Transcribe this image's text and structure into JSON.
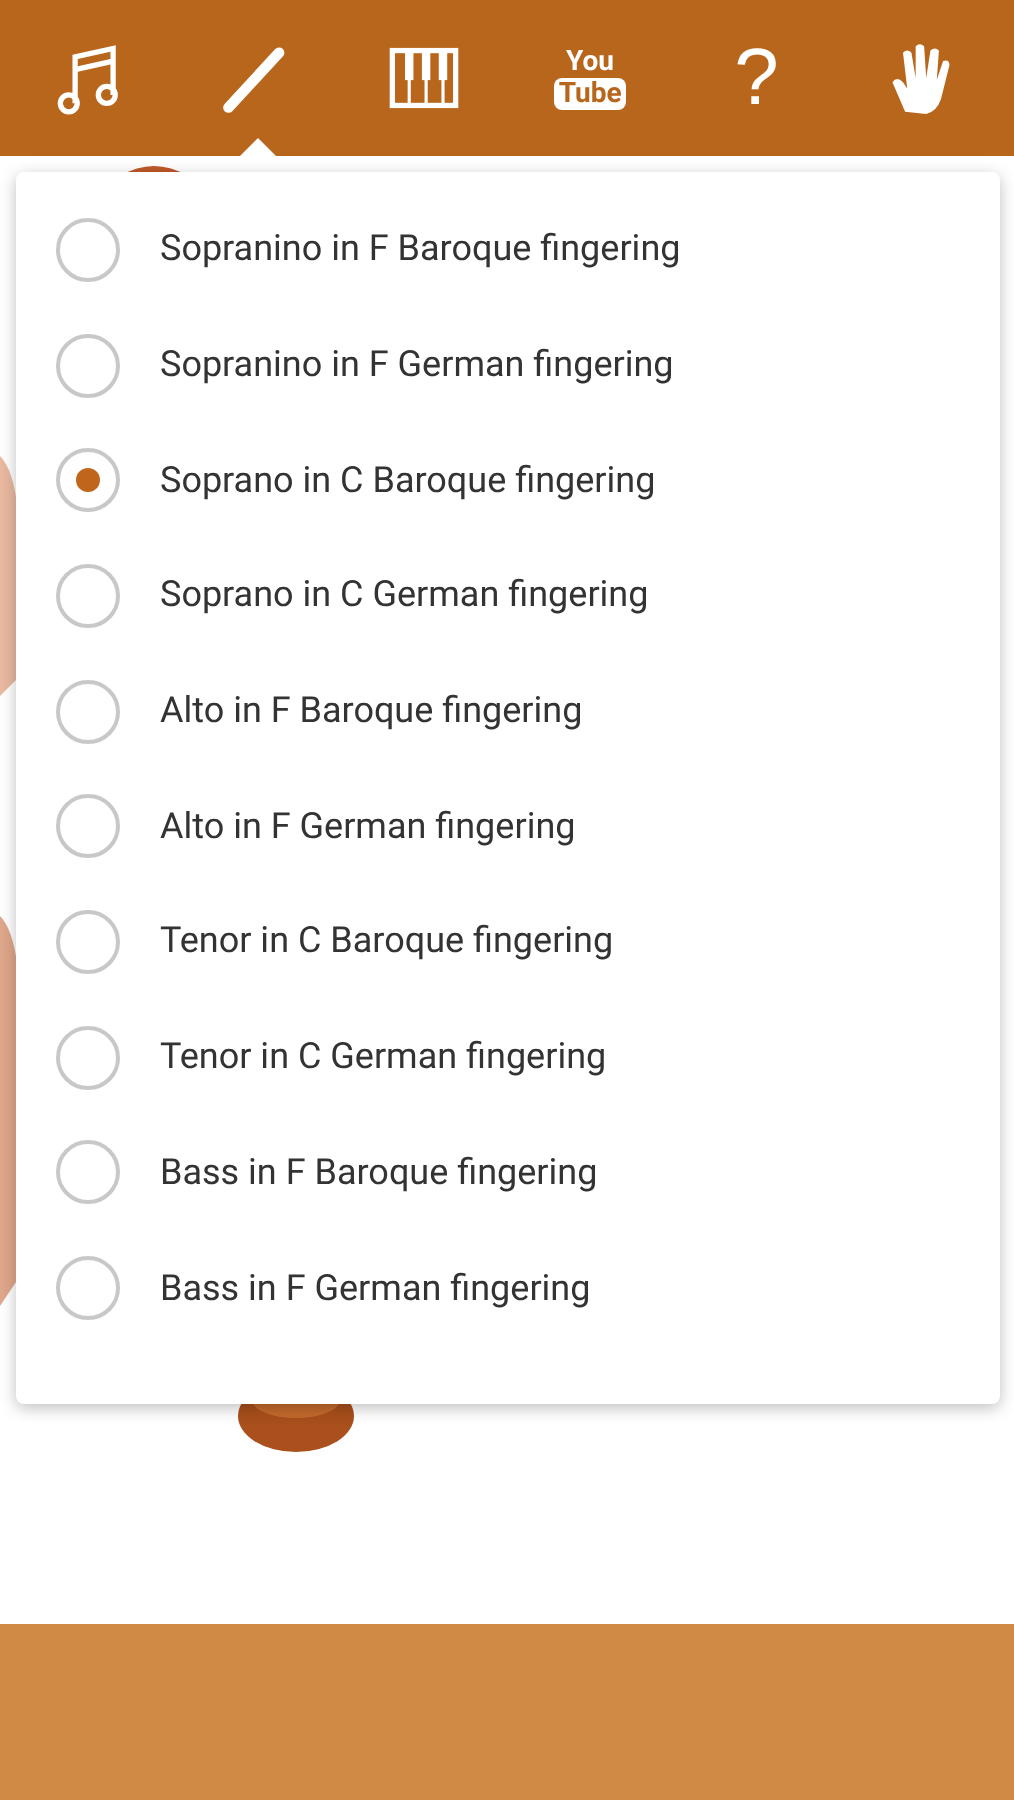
{
  "toolbar": [
    {
      "kind": "notes",
      "selected": false
    },
    {
      "kind": "recorder",
      "selected": true
    },
    {
      "kind": "keyboard",
      "selected": false
    },
    {
      "kind": "youtube",
      "selected": false,
      "text_top": "You",
      "text_bottom": "Tube"
    },
    {
      "kind": "help",
      "selected": false,
      "text": "?"
    },
    {
      "kind": "hand",
      "selected": false
    }
  ],
  "fingering_menu": {
    "options": [
      {
        "label": "Sopranino in F Baroque fingering",
        "selected": false
      },
      {
        "label": "Sopranino in F German fingering",
        "selected": false
      },
      {
        "label": "Soprano in C Baroque fingering",
        "selected": true
      },
      {
        "label": "Soprano in C German fingering",
        "selected": false
      },
      {
        "label": "Alto in F Baroque fingering",
        "selected": false
      },
      {
        "label": "Alto in F German fingering",
        "selected": false
      },
      {
        "label": "Tenor in C Baroque fingering",
        "selected": false
      },
      {
        "label": "Tenor in C German fingering",
        "selected": false
      },
      {
        "label": "Bass in F Baroque fingering",
        "selected": false
      },
      {
        "label": "Bass in F German fingering",
        "selected": false
      }
    ]
  }
}
